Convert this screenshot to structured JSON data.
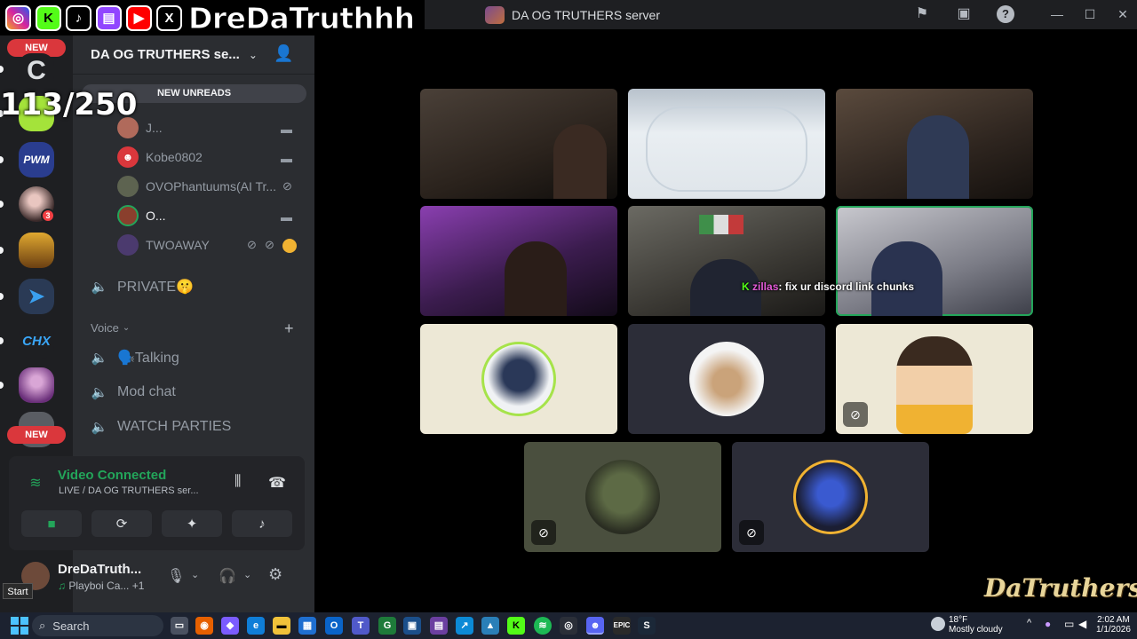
{
  "window": {
    "title": "DA OG TRUTHERS server"
  },
  "overlay": {
    "socials": [
      "instagram-icon",
      "kick-icon",
      "tiktok-icon",
      "twitch-icon",
      "youtube-icon",
      "x-icon"
    ],
    "streamer_name": "DreDaTruthhh",
    "counter": "113/250",
    "watermark": "DaTruthers"
  },
  "rail": {
    "new_top": "NEW",
    "new_bottom": "NEW",
    "mention_count": "3",
    "servers": [
      "C",
      "PWM",
      "CHX"
    ]
  },
  "sidebar": {
    "server_name": "DA OG TRUTHERS se...",
    "new_unreads": "NEW UNREADS",
    "voice_users": [
      {
        "name": "J...",
        "status": "video"
      },
      {
        "name": "Kobe0802",
        "status": "video"
      },
      {
        "name": "OVOPhantuums(AI Tr...",
        "status": "muted"
      },
      {
        "name": "O...",
        "status": "video"
      },
      {
        "name": "TWOAWAY",
        "status": "muted-deafened"
      }
    ],
    "private_channel": "PRIVATE🤫",
    "voice_category": "Voice",
    "voice_channels": [
      "🗣️Talking",
      "Mod chat",
      "WATCH PARTIES"
    ]
  },
  "voice_panel": {
    "title": "Video Connected",
    "subtitle": "LIVE / DA OG TRUTHERS ser..."
  },
  "user_panel": {
    "name": "DreDaTruth...",
    "status": "Playboi Ca...",
    "extra": "+1"
  },
  "stage": {
    "chat_overlay_user": "zillas",
    "chat_overlay_text": ": fix ur discord link chunks"
  },
  "taskbar": {
    "start_tooltip": "Start",
    "search_placeholder": "Search",
    "weather_temp": "18°F",
    "weather_desc": "Mostly cloudy",
    "time": "2:02 AM",
    "date": "1/1/2026"
  },
  "colors": {
    "accent_green": "#23a55a",
    "danger": "#da373c",
    "background": "#1e1f22",
    "sidebar": "#2b2d31"
  }
}
